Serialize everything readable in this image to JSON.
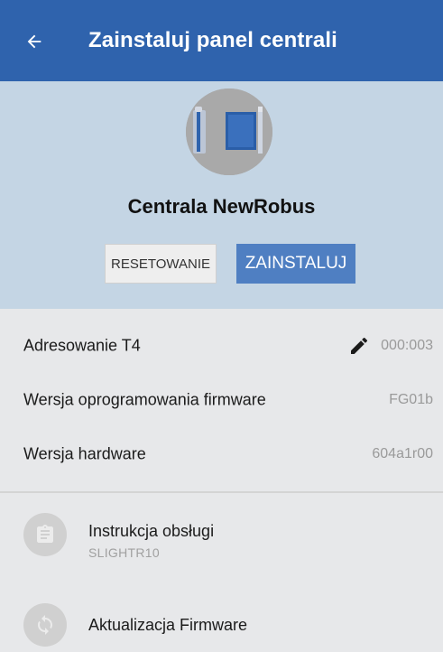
{
  "appbar": {
    "back_icon": "arrow-back-icon",
    "title": "Zainstaluj panel centrali",
    "color": "#2f63ad"
  },
  "hero": {
    "device_icon": "control-unit-icon",
    "device_name": "Centrala NewRobus",
    "reset_label": "RESETOWANIE",
    "install_label": "ZAINSTALUJ",
    "background": "#c4d5e4"
  },
  "info": {
    "rows": [
      {
        "label": "Adresowanie T4",
        "value": "000:003",
        "icon": "pencil-icon"
      },
      {
        "label": "Wersja oprogramowania firmware",
        "value": "FG01b"
      },
      {
        "label": "Wersja hardware",
        "value": "604a1r00"
      }
    ]
  },
  "list": {
    "items": [
      {
        "title": "Instrukcja obsługi",
        "subtitle": "SLIGHTR10",
        "icon": "clipboard-icon"
      },
      {
        "title": "Aktualizacja Firmware",
        "icon": "sync-icon"
      }
    ]
  }
}
